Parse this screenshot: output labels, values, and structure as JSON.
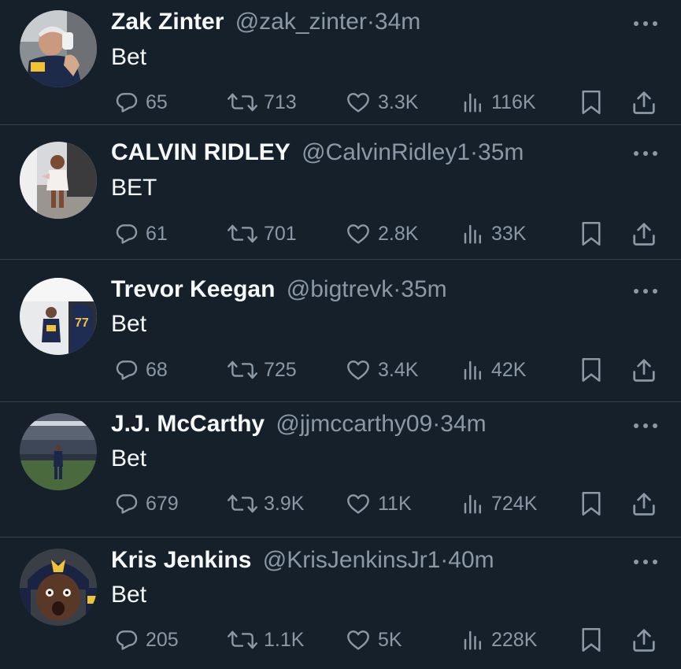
{
  "colors": {
    "background": "#15202b",
    "text": "#f7f9f9",
    "muted": "#8b98a5",
    "divider": "#38444d"
  },
  "icons": [
    "reply-icon",
    "retweet-icon",
    "like-icon",
    "views-icon",
    "bookmark-icon",
    "share-icon",
    "more-icon"
  ],
  "tweets": [
    {
      "name": "Zak Zinter",
      "handle": "@zak_zinter",
      "separator": "·",
      "time": "34m",
      "text": "Bet",
      "replies": "65",
      "retweets": "713",
      "likes": "3.3K",
      "views": "116K"
    },
    {
      "name": "CALVIN RIDLEY",
      "handle": "@CalvinRidley1",
      "separator": "·",
      "time": "35m",
      "text": "BET",
      "replies": "61",
      "retweets": "701",
      "likes": "2.8K",
      "views": "33K"
    },
    {
      "name": "Trevor Keegan",
      "handle": "@bigtrevk",
      "separator": "·",
      "time": "35m",
      "text": "Bet",
      "replies": "68",
      "retweets": "725",
      "likes": "3.4K",
      "views": "42K"
    },
    {
      "name": "J.J. McCarthy",
      "handle": "@jjmccarthy09",
      "separator": "·",
      "time": "34m",
      "text": "Bet",
      "replies": "679",
      "retweets": "3.9K",
      "likes": "11K",
      "views": "724K"
    },
    {
      "name": "Kris Jenkins",
      "handle": "@KrisJenkinsJr1",
      "separator": "·",
      "time": "40m",
      "text": "Bet",
      "replies": "205",
      "retweets": "1.1K",
      "likes": "5K",
      "views": "228K"
    }
  ]
}
